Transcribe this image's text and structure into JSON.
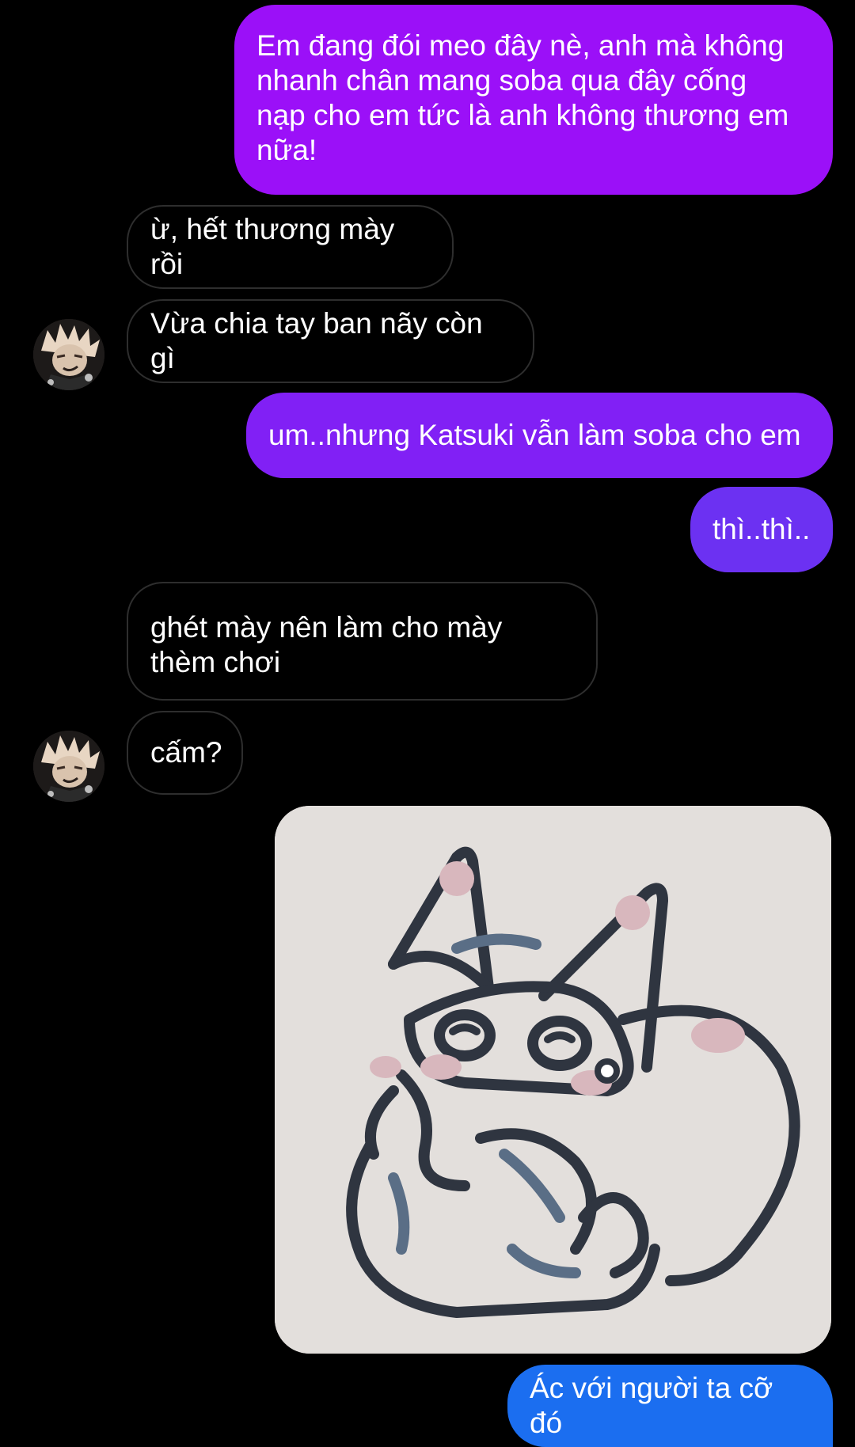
{
  "colors": {
    "background": "#000000",
    "outgoing_1": "#9b10f8",
    "outgoing_2": "#8120f5",
    "outgoing_3": "#6c31f2",
    "outgoing_4": "#1b6ef0",
    "incoming_border": "#2e2e2e",
    "text": "#ffffff"
  },
  "messages": [
    {
      "side": "outgoing",
      "text": "Em đang đói meo đây nè, anh mà không\nnhanh chân mang soba qua đây cống\nnạp cho em tức là anh không thương em\nnữa!"
    },
    {
      "side": "incoming",
      "text": "ừ, hết thương mày rồi"
    },
    {
      "side": "incoming",
      "text": "Vừa chia tay ban nãy còn gì"
    },
    {
      "side": "outgoing",
      "text": "um..nhưng Katsuki vẫn làm soba cho em"
    },
    {
      "side": "outgoing",
      "text": "thì..thì.."
    },
    {
      "side": "incoming",
      "text": "ghét mày nên làm cho mày\nthèm chơi"
    },
    {
      "side": "incoming",
      "text": "cấm?"
    },
    {
      "side": "outgoing",
      "type": "image",
      "image_icon": "crying-cat-sticker"
    },
    {
      "side": "outgoing",
      "text": "Ác với người ta cỡ đó"
    }
  ],
  "avatars": [
    {
      "icon": "contact-avatar",
      "after_message": 2
    },
    {
      "icon": "contact-avatar",
      "after_message": 6
    }
  ]
}
